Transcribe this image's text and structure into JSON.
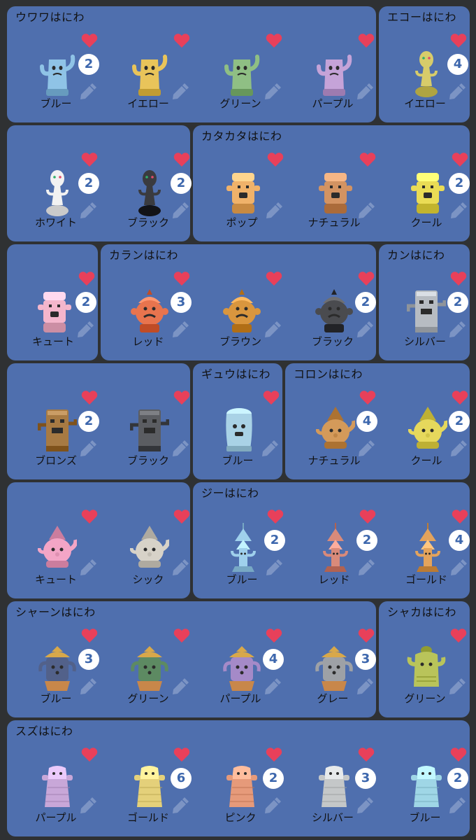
{
  "groups": [
    {
      "name": "ウワワはにわ",
      "items": [
        {
          "label": "ブルー",
          "count": "2",
          "color": "#8fc3e6",
          "shape": "uwawa"
        },
        {
          "label": "イエロー",
          "count": "",
          "color": "#e9c45a",
          "shape": "uwawa"
        },
        {
          "label": "グリーン",
          "count": "",
          "color": "#8fbf84",
          "shape": "uwawa"
        },
        {
          "label": "パープル",
          "count": "",
          "color": "#c5a3d8",
          "shape": "uwawa"
        }
      ]
    },
    {
      "name": "エコーはにわ",
      "items": [
        {
          "label": "イエロー",
          "count": "4",
          "color": "#d7cc6a",
          "shape": "echo"
        }
      ]
    },
    {
      "name": "",
      "items": [
        {
          "label": "ホワイト",
          "count": "2",
          "color": "#f2f2f2",
          "shape": "echo"
        },
        {
          "label": "ブラック",
          "count": "2",
          "color": "#3a3b3f",
          "shape": "echo"
        }
      ]
    },
    {
      "name": "カタカタはにわ",
      "items": [
        {
          "label": "ポップ",
          "count": "",
          "color": "#f0b26a",
          "shape": "kata"
        },
        {
          "label": "ナチュラル",
          "count": "",
          "color": "#d39362",
          "shape": "kata"
        },
        {
          "label": "クール",
          "count": "2",
          "color": "#eadc55",
          "shape": "kata"
        }
      ]
    },
    {
      "name": "",
      "items": [
        {
          "label": "キュート",
          "count": "2",
          "color": "#f4b6cc",
          "shape": "kata"
        }
      ]
    },
    {
      "name": "カランはにわ",
      "items": [
        {
          "label": "レッド",
          "count": "3",
          "color": "#e8744e",
          "shape": "karan"
        },
        {
          "label": "ブラウン",
          "count": "",
          "color": "#d9963e",
          "shape": "karan"
        },
        {
          "label": "ブラック",
          "count": "2",
          "color": "#4a4b4f",
          "shape": "karan"
        }
      ]
    },
    {
      "name": "カンはにわ",
      "items": [
        {
          "label": "シルバー",
          "count": "2",
          "color": "#b7bcc2",
          "shape": "kan"
        }
      ]
    },
    {
      "name": "",
      "items": [
        {
          "label": "ブロンズ",
          "count": "2",
          "color": "#a77a43",
          "shape": "kan"
        },
        {
          "label": "ブラック",
          "count": "",
          "color": "#5b5d62",
          "shape": "kan"
        }
      ]
    },
    {
      "name": "ギュウはにわ",
      "items": [
        {
          "label": "ブルー",
          "count": "",
          "color": "#a9d2e6",
          "shape": "gyuu"
        }
      ]
    },
    {
      "name": "コロンはにわ",
      "items": [
        {
          "label": "ナチュラル",
          "count": "4",
          "color": "#d49a5a",
          "shape": "koron"
        },
        {
          "label": "クール",
          "count": "2",
          "color": "#e6d85c",
          "shape": "koron"
        }
      ]
    },
    {
      "name": "",
      "items": [
        {
          "label": "キュート",
          "count": "",
          "color": "#f3a5c6",
          "shape": "koron"
        },
        {
          "label": "シック",
          "count": "",
          "color": "#d7d2c8",
          "shape": "koron"
        }
      ]
    },
    {
      "name": "ジーはにわ",
      "items": [
        {
          "label": "ブルー",
          "count": "2",
          "color": "#9fd0ec",
          "shape": "jii"
        },
        {
          "label": "レッド",
          "count": "2",
          "color": "#d98a7a",
          "shape": "jii"
        },
        {
          "label": "ゴールド",
          "count": "4",
          "color": "#e3a35c",
          "shape": "jii"
        }
      ]
    },
    {
      "name": "シャーンはにわ",
      "items": [
        {
          "label": "ブルー",
          "count": "3",
          "color": "#52618a",
          "shape": "shaan"
        },
        {
          "label": "グリーン",
          "count": "",
          "color": "#5d8a62",
          "shape": "shaan"
        },
        {
          "label": "パープル",
          "count": "4",
          "color": "#a58ac8",
          "shape": "shaan"
        },
        {
          "label": "グレー",
          "count": "3",
          "color": "#9ea1a6",
          "shape": "shaan"
        }
      ]
    },
    {
      "name": "シャカはにわ",
      "items": [
        {
          "label": "グリーン",
          "count": "",
          "color": "#b9c45a",
          "shape": "shaka"
        }
      ]
    },
    {
      "name": "スズはにわ",
      "items": [
        {
          "label": "パープル",
          "count": "",
          "color": "#c8a7d8",
          "shape": "suzu"
        },
        {
          "label": "ゴールド",
          "count": "6",
          "color": "#e4d07a",
          "shape": "suzu"
        },
        {
          "label": "ピンク",
          "count": "2",
          "color": "#e69a7a",
          "shape": "suzu"
        },
        {
          "label": "シルバー",
          "count": "3",
          "color": "#c4c7c8",
          "shape": "suzu"
        },
        {
          "label": "ブルー",
          "count": "2",
          "color": "#9fd6e6",
          "shape": "suzu"
        }
      ]
    }
  ],
  "colors": {
    "panel": "#4f6fae",
    "badge_text": "#3d67ad",
    "heart": "#e8405a"
  },
  "icons": {
    "heart": "heart-icon",
    "edit": "pencil-icon"
  }
}
